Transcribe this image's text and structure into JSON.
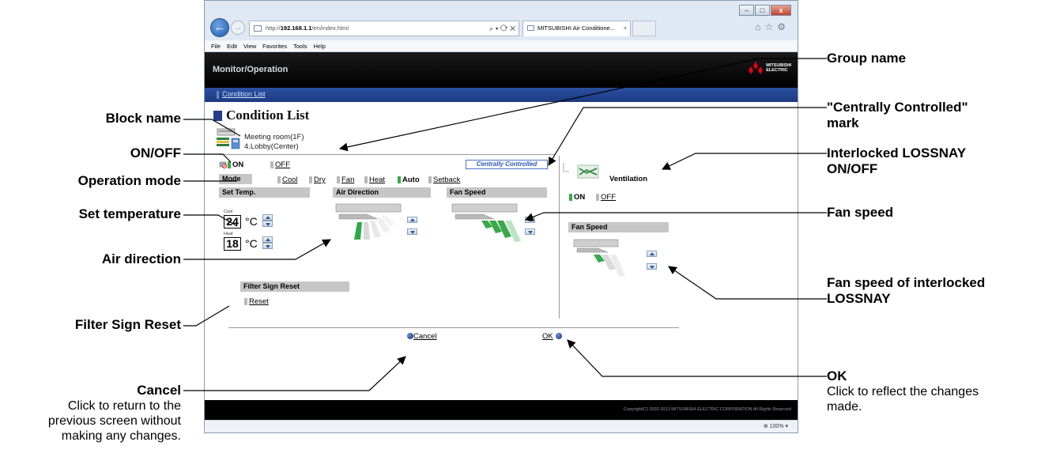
{
  "browser": {
    "address_prefix": "http://",
    "address_host": "192.168.1.1",
    "address_path": "/en/index.html",
    "address_tools": "⌕ ▾ ⟳ ✕",
    "tab_title": "MITSUBISHI Air Conditione...",
    "tab_close": "×",
    "back_glyph": "←",
    "forward_glyph": "→",
    "toolbar_glyphs": "⌂☆⚙",
    "menu": [
      "File",
      "Edit",
      "View",
      "Favorites",
      "Tools",
      "Help"
    ],
    "window_buttons": {
      "minimize": "–",
      "maximize": "□",
      "close": "x"
    },
    "zoom": "⊕ 100%  ▾"
  },
  "app": {
    "title": "Monitor/Operation",
    "logo_line1": "MITSUBISHI",
    "logo_line2": "ELECTRIC",
    "nav_link": "Condition List",
    "heading": "Condition List",
    "block_name": "Meeting room(1F)",
    "group_name": "4.Lobby(Center)",
    "copyright": "Copyright(C) 2002-2013 MITSUBISHI ELECTRIC CORPORATION All Rights Reserved"
  },
  "controls": {
    "on_label": "ON",
    "off_label": "OFF",
    "centrally_controlled": "Centrally Controlled",
    "mode_label": "Mode",
    "modes": [
      "Cool",
      "Dry",
      "Fan",
      "Heat",
      "Auto",
      "Setback"
    ],
    "selected_mode": "Auto",
    "set_temp_label": "Set Temp.",
    "cool_label": "Cool",
    "heat_label": "Heat",
    "cool_temp": "24",
    "heat_temp": "18",
    "temp_unit": "°C",
    "air_direction_label": "Air Direction",
    "fan_speed_label": "Fan Speed",
    "filter_sign_reset_label": "Filter Sign Reset",
    "reset_link": "Reset",
    "cancel": "Cancel",
    "ok": "OK"
  },
  "lossnay": {
    "name": "Ventilation",
    "on_label": "ON",
    "off_label": "OFF",
    "fan_speed_label": "Fan Speed"
  },
  "callouts": {
    "block_name": "Block name",
    "on_off": "ON/OFF",
    "operation_mode": "Operation mode",
    "set_temperature": "Set temperature",
    "air_direction": "Air direction",
    "filter_sign_reset": "Filter Sign Reset",
    "cancel_title": "Cancel",
    "cancel_desc": [
      "Click to return to the",
      "previous screen without",
      "making any changes."
    ],
    "group_name": "Group name",
    "centrally_controlled_1": "\"Centrally Controlled\"",
    "centrally_controlled_2": "mark",
    "interlocked_1": "Interlocked LOSSNAY",
    "interlocked_2": "ON/OFF",
    "fan_speed": "Fan speed",
    "fan_speed_lossnay_1": "Fan speed of interlocked",
    "fan_speed_lossnay_2": "LOSSNAY",
    "ok_title": "OK",
    "ok_desc": [
      "Click to reflect the changes",
      "made."
    ]
  }
}
